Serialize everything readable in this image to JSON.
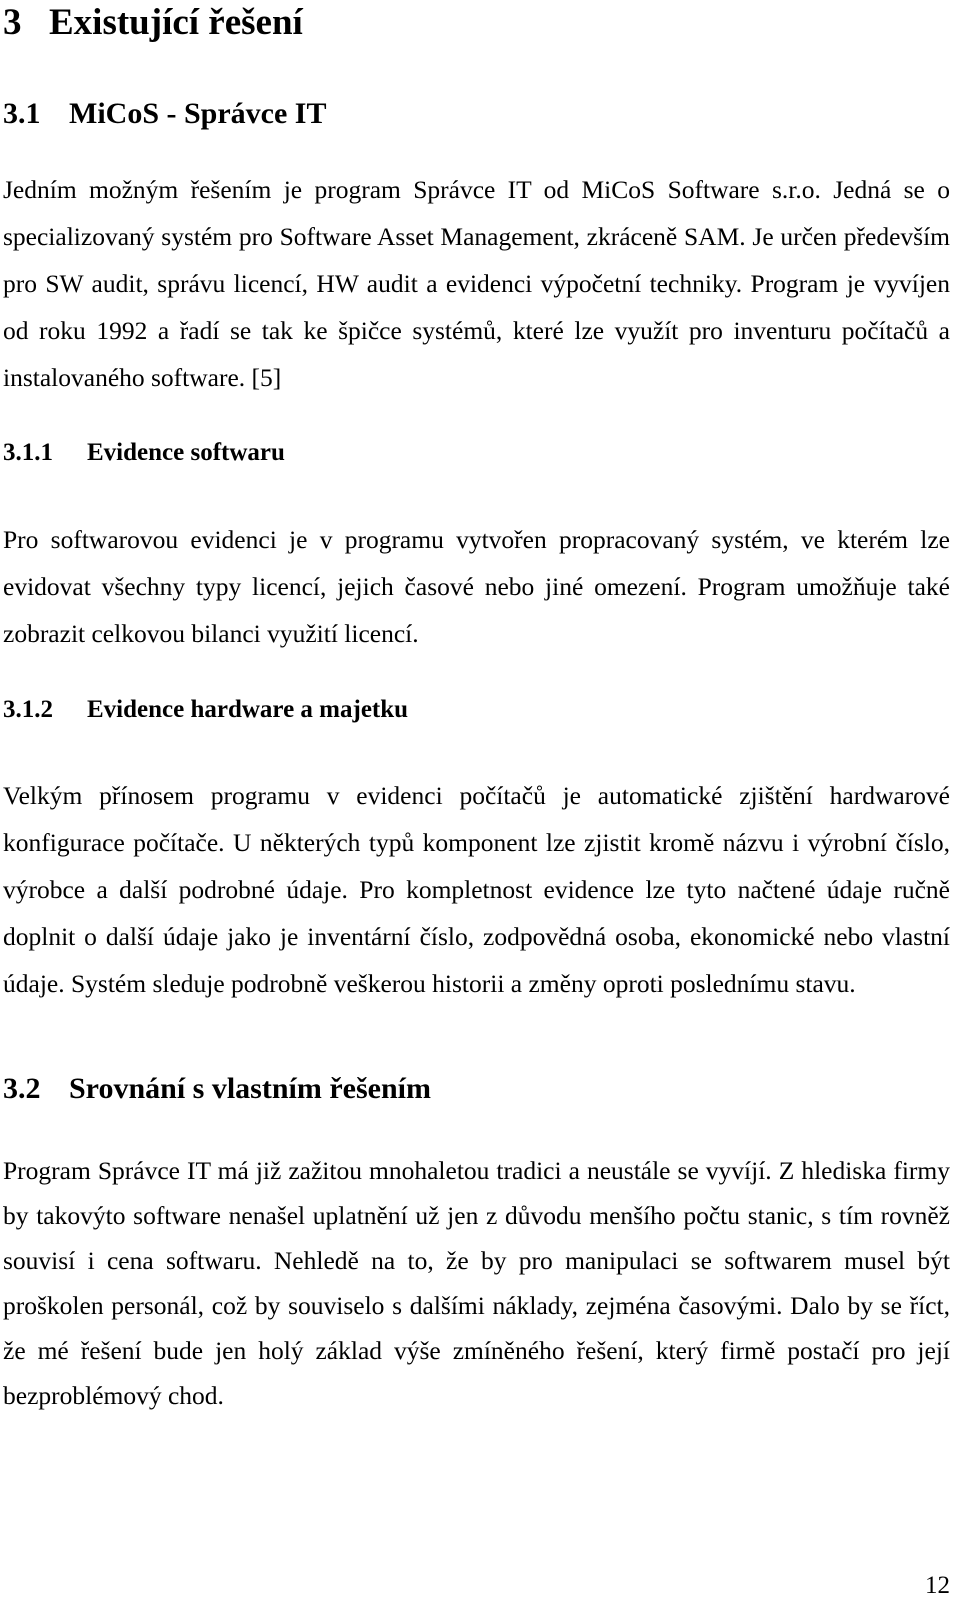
{
  "document": {
    "language": "cs",
    "page_number": "12",
    "text_color": "#000000",
    "background_color": "#ffffff"
  },
  "headings": {
    "section_3": {
      "number": "3",
      "title": "Existující řešení"
    },
    "section_3_1": {
      "number": "3.1",
      "title": "MiCoS - Správce IT"
    },
    "section_3_1_1": {
      "number": "3.1.1",
      "title": "Evidence softwaru"
    },
    "section_3_1_2": {
      "number": "3.1.2",
      "title": "Evidence hardware a majetku"
    },
    "section_3_2": {
      "number": "3.2",
      "title": "Srovnání s vlastním řešením"
    }
  },
  "paragraphs": {
    "intro": "Jedním možným řešením je program Správce IT od MiCoS Software s.r.o. Jedná se o specializovaný systém pro Software Asset Management, zkráceně SAM. Je určen především pro SW audit, správu licencí, HW audit a evidenci výpočetní techniky. Program je vyvíjen od roku 1992 a řadí se tak ke špičce systémů, které lze využít pro inventuru počítačů a instalovaného software. [5]",
    "software_evidence": "Pro softwarovou evidenci je v programu vytvořen propracovaný systém, ve kterém lze evidovat všechny typy licencí, jejich časové nebo jiné omezení. Program umožňuje také zobrazit celkovou bilanci využití licencí.",
    "hardware_evidence": "Velkým přínosem programu v evidenci počítačů je automatické zjištění hardwarové konfigurace počítače. U některých typů komponent lze zjistit kromě názvu i výrobní číslo, výrobce a další podrobné údaje. Pro kompletnost evidence lze tyto načtené údaje ručně doplnit o další údaje jako je inventární číslo, zodpovědná osoba, ekonomické nebo vlastní údaje. Systém sleduje podrobně veškerou historii a změny oproti poslednímu stavu.",
    "comparison": "Program Správce IT má již zažitou mnohaletou tradici a neustále se vyvíjí. Z hlediska firmy by takovýto software nenašel uplatnění už jen z důvodu menšího počtu stanic, s tím rovněž souvisí i cena softwaru. Nehledě na to, že by pro manipulaci se softwarem musel být proškolen personál, což by souviselo s dalšími náklady, zejména časovými. Dalo by se říct, že mé řešení bude jen holý základ výše zmíněného řešení, který firmě postačí pro její bezproblémový chod."
  }
}
